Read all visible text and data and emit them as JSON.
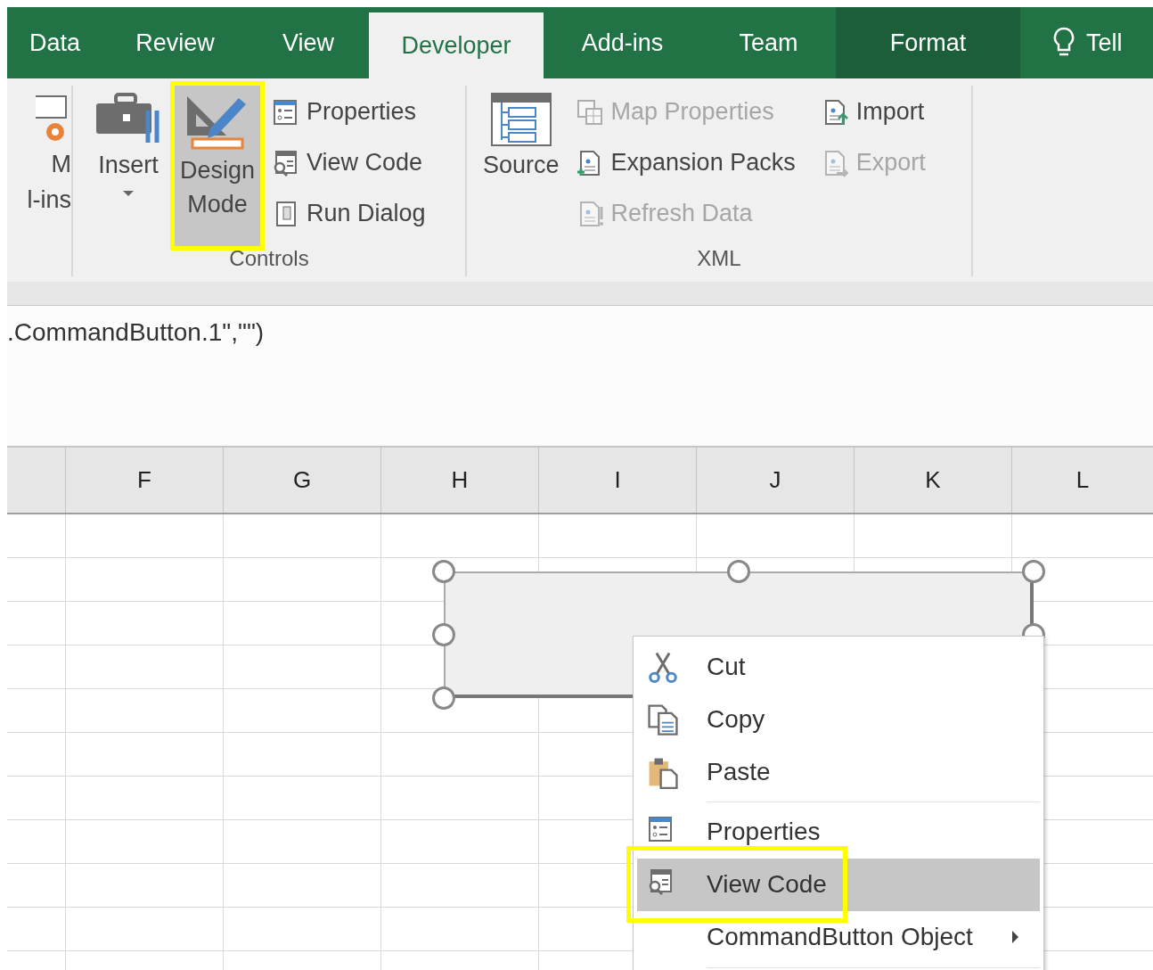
{
  "tabs": [
    {
      "label": "Data",
      "selected": false,
      "kind": "tab"
    },
    {
      "label": "Review",
      "selected": false,
      "kind": "tab"
    },
    {
      "label": "View",
      "selected": false,
      "kind": "tab"
    },
    {
      "label": "Developer",
      "selected": true,
      "kind": "tab"
    },
    {
      "label": "Add-ins",
      "selected": false,
      "kind": "tab"
    },
    {
      "label": "Team",
      "selected": false,
      "kind": "tab"
    },
    {
      "label": "Format",
      "selected": false,
      "kind": "context"
    },
    {
      "label": "Tell",
      "selected": false,
      "kind": "tell"
    }
  ],
  "ribbon": {
    "partial_group": {
      "lines": [
        "M",
        "l-ins"
      ]
    },
    "controls_group": {
      "label": "Controls",
      "large_buttons": [
        {
          "lines": [
            "Insert"
          ],
          "dropdown": true,
          "selected": false,
          "highlighted": false
        },
        {
          "lines": [
            "Design",
            "Mode"
          ],
          "dropdown": false,
          "selected": true,
          "highlighted": true
        }
      ],
      "small_buttons": [
        {
          "label": "Properties",
          "disabled": false
        },
        {
          "label": "View Code",
          "disabled": false
        },
        {
          "label": "Run Dialog",
          "disabled": false
        }
      ]
    },
    "xml_group": {
      "label": "XML",
      "large_buttons": [
        {
          "lines": [
            "Source"
          ],
          "dropdown": false,
          "selected": false,
          "highlighted": false
        }
      ],
      "small_buttons": [
        {
          "label": "Map Properties",
          "disabled": true
        },
        {
          "label": "Expansion Packs",
          "disabled": false
        },
        {
          "label": "Refresh Data",
          "disabled": true
        }
      ],
      "small_buttons_2": [
        {
          "label": "Import",
          "disabled": false
        },
        {
          "label": "Export",
          "disabled": true
        }
      ]
    }
  },
  "formula_bar": {
    "text": ".CommandButton.1\",\"\")"
  },
  "columns": [
    "F",
    "G",
    "H",
    "I",
    "J",
    "K",
    "L"
  ],
  "control": {
    "selected": true
  },
  "context_menu": [
    {
      "kind": "item",
      "label": "Cut",
      "selected": false,
      "highlighted": false,
      "submenu": false
    },
    {
      "kind": "item",
      "label": "Copy",
      "selected": false,
      "highlighted": false,
      "submenu": false
    },
    {
      "kind": "item",
      "label": "Paste",
      "selected": false,
      "highlighted": false,
      "submenu": false
    },
    {
      "kind": "separator"
    },
    {
      "kind": "item",
      "label": "Properties",
      "selected": false,
      "highlighted": false,
      "submenu": false
    },
    {
      "kind": "item",
      "label": "View Code",
      "selected": true,
      "highlighted": true,
      "submenu": false
    },
    {
      "kind": "item",
      "label": "CommandButton Object",
      "selected": false,
      "highlighted": false,
      "submenu": true
    },
    {
      "kind": "separator"
    }
  ]
}
